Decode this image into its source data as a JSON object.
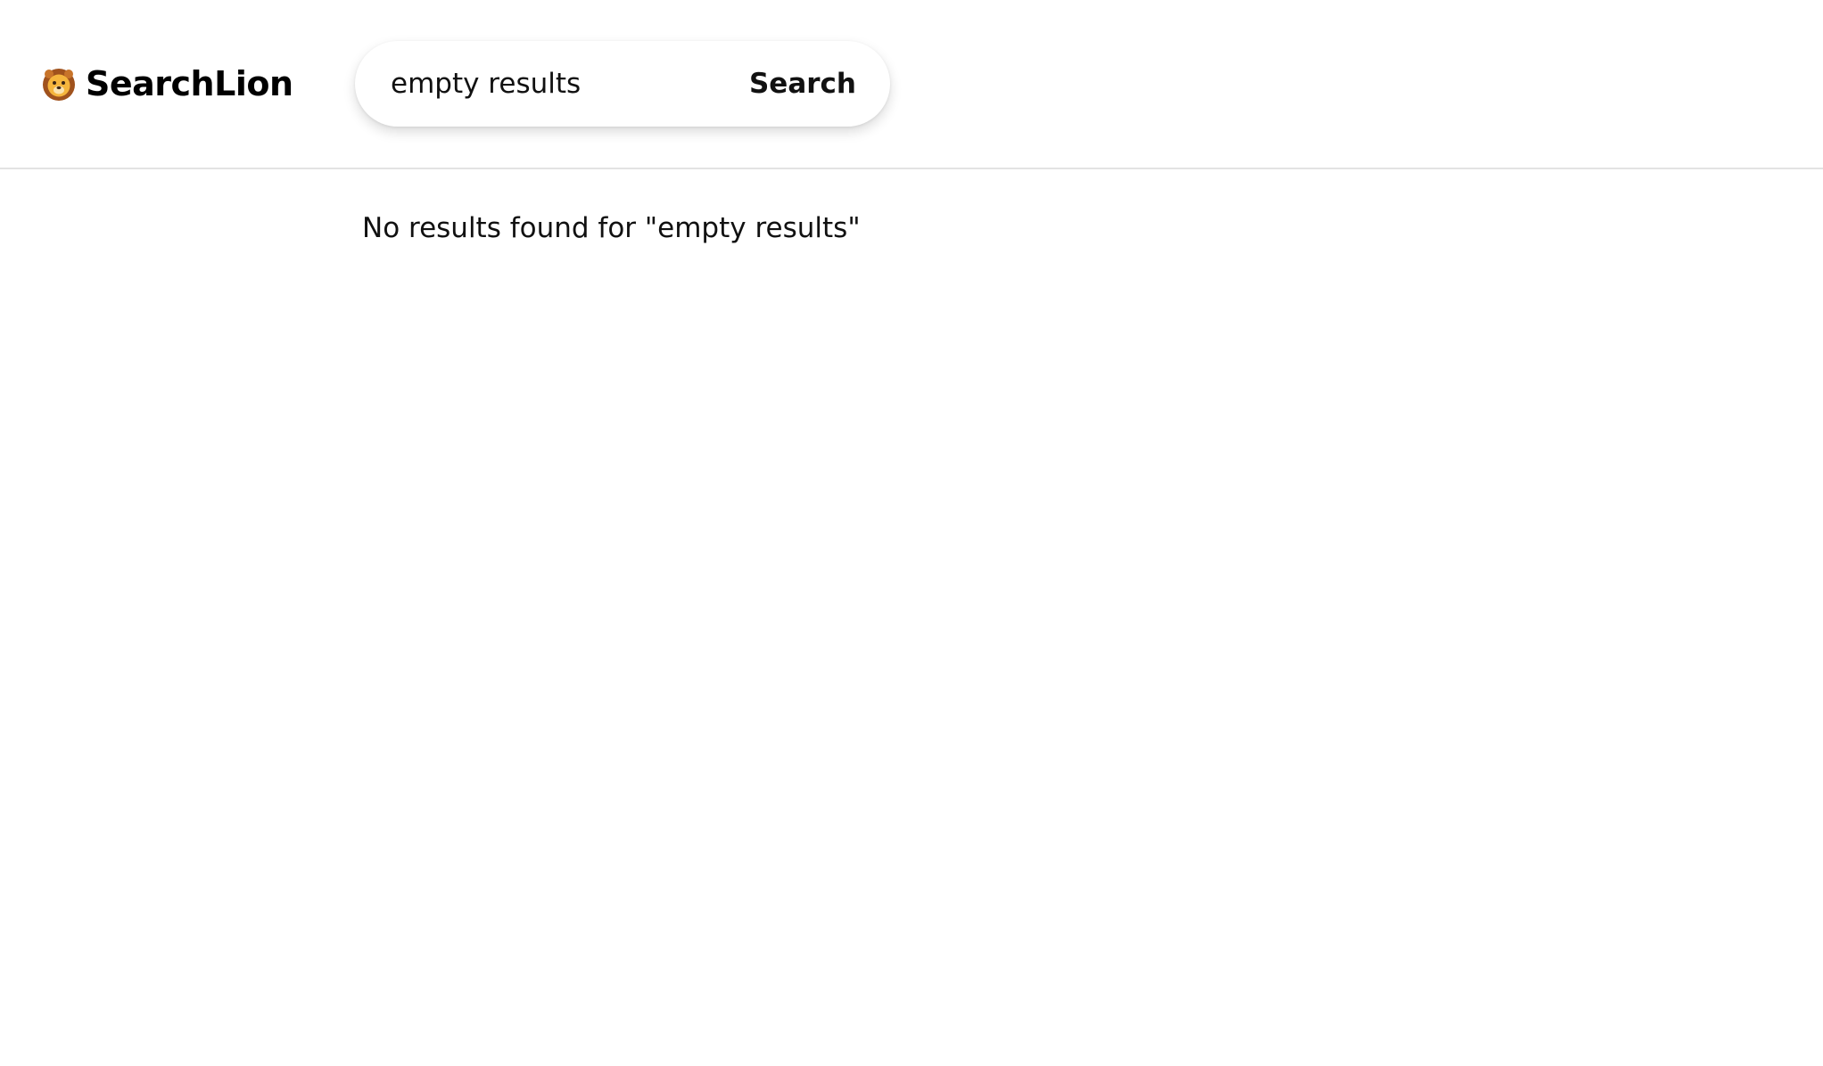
{
  "header": {
    "logo_icon": "lion-icon",
    "logo_text": "SearchLion"
  },
  "search": {
    "value": "empty results",
    "button_label": "Search"
  },
  "results": {
    "message": "No results found for \"empty results\""
  }
}
